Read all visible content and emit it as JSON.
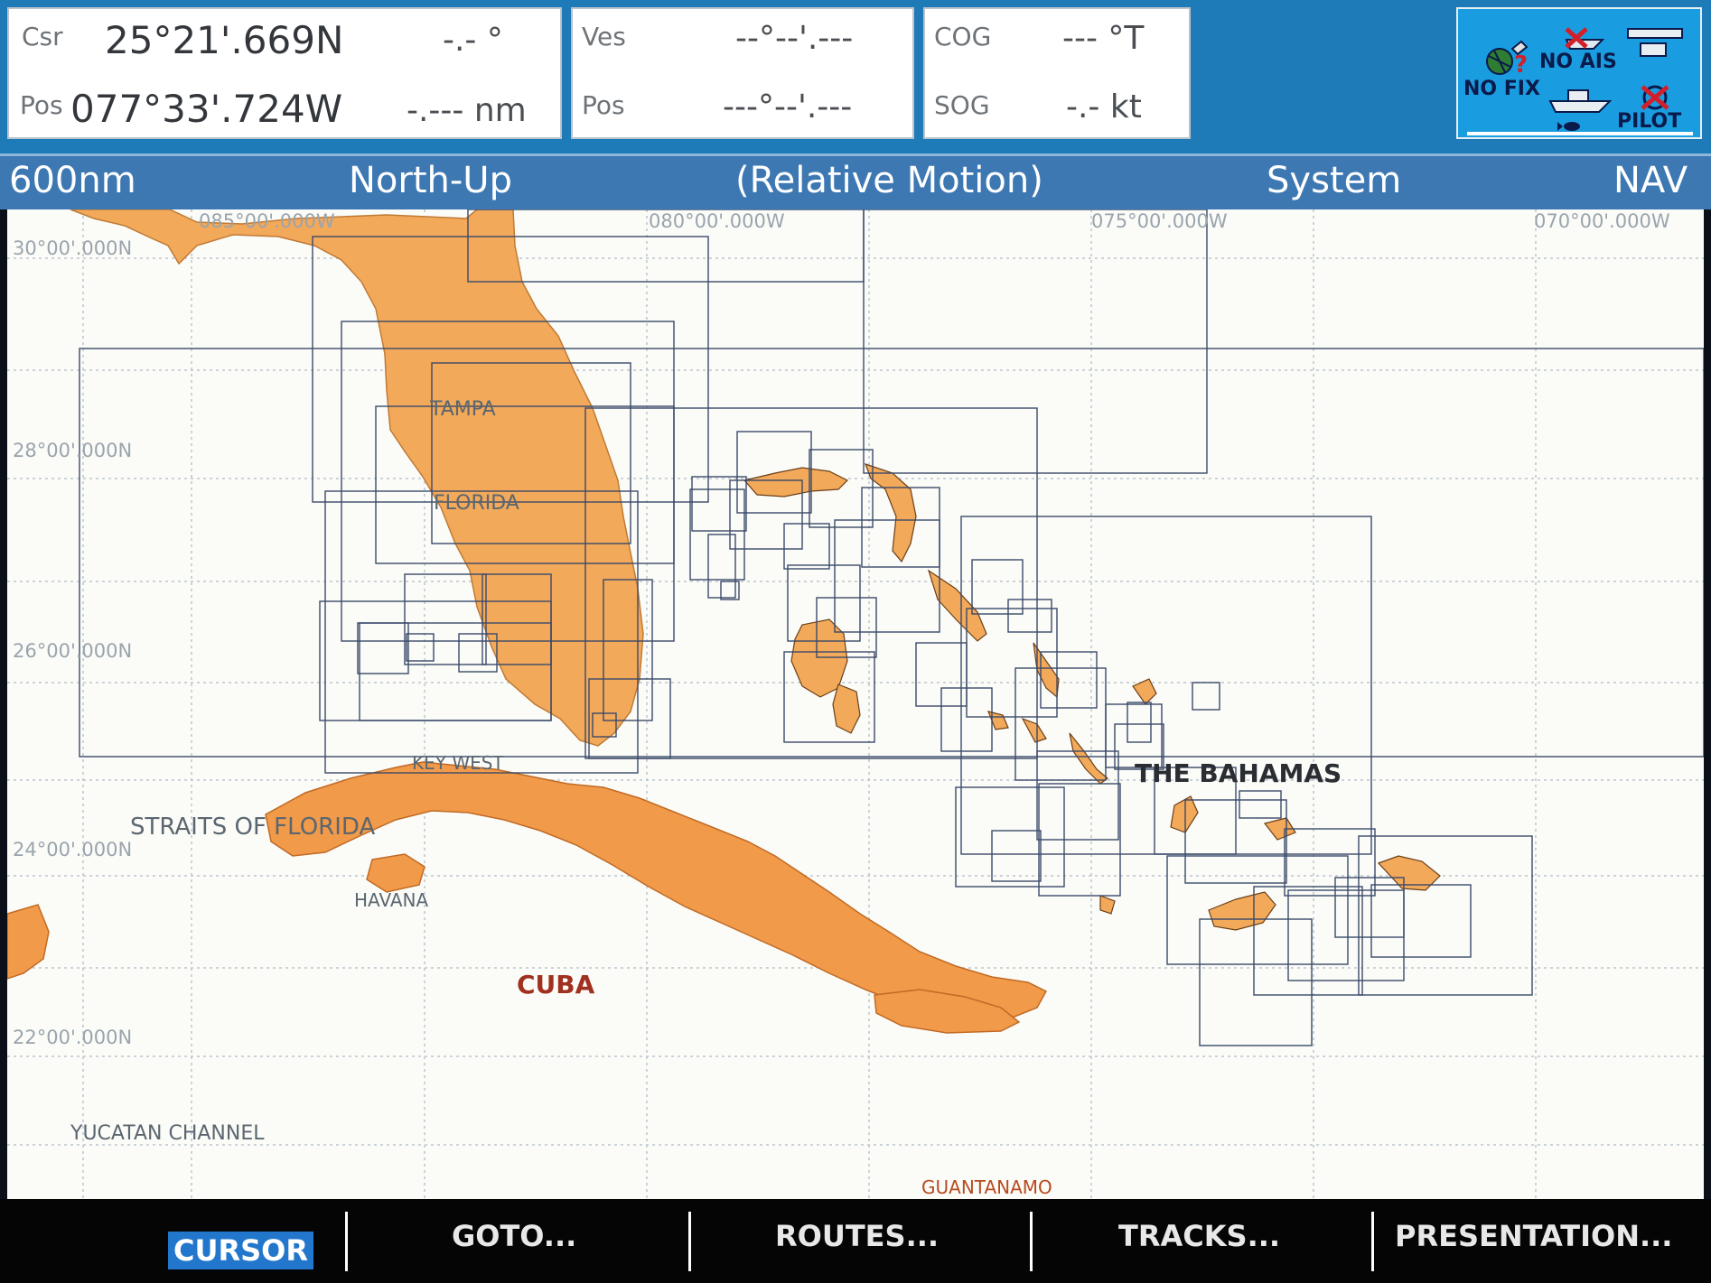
{
  "data_bar": {
    "cursor": {
      "label_csr": "Csr",
      "label_pos": "Pos",
      "lat": "25°21'.669N",
      "lon": "077°33'.724W",
      "bearing": "-.- °",
      "range": "-.--- nm"
    },
    "vessel": {
      "label_ves": "Ves",
      "label_pos": "Pos",
      "lat": "--°--'.---",
      "lon": "---°--'.---"
    },
    "course": {
      "label_cog": "COG",
      "label_sog": "SOG",
      "cog": "--- °T",
      "sog": "-.- kt"
    },
    "status": {
      "no_ais": "NO AIS",
      "no_fix": "NO FIX",
      "pilot": "PILOT"
    }
  },
  "header": {
    "range": "600nm",
    "orientation": "North-Up",
    "motion": "(Relative Motion)",
    "datum": "System",
    "mode": "NAV"
  },
  "chart": {
    "longitudes": [
      "085°00'.000W",
      "080°00'.000W",
      "075°00'.000W",
      "070°00'.000W"
    ],
    "latitudes": [
      "30°00'.000N",
      "28°00'.000N",
      "26°00'.000N",
      "24°00'.000N",
      "22°00'.000N"
    ],
    "places": {
      "tampa": "TAMPA",
      "florida": "FLORIDA",
      "key_west": "KEY WEST",
      "straits": "STRAITS OF FLORIDA",
      "havana": "HAVANA",
      "cuba": "CUBA",
      "bahamas": "THE BAHAMAS",
      "yucatan": "YUCATAN CHANNEL",
      "guantanamo": "GUANTANAMO"
    },
    "land_color": "#f2a95a",
    "land_color_cuba": "#f19a49",
    "water_color": "#fbfcf8",
    "grid_color": "#b9c2cb",
    "cell_outline_color": "#3b4a6a"
  },
  "softkeys": {
    "cursor": "CURSOR",
    "goto": "GOTO...",
    "routes": "ROUTES...",
    "tracks": "TRACKS...",
    "presentation": "PRESENTATION..."
  }
}
